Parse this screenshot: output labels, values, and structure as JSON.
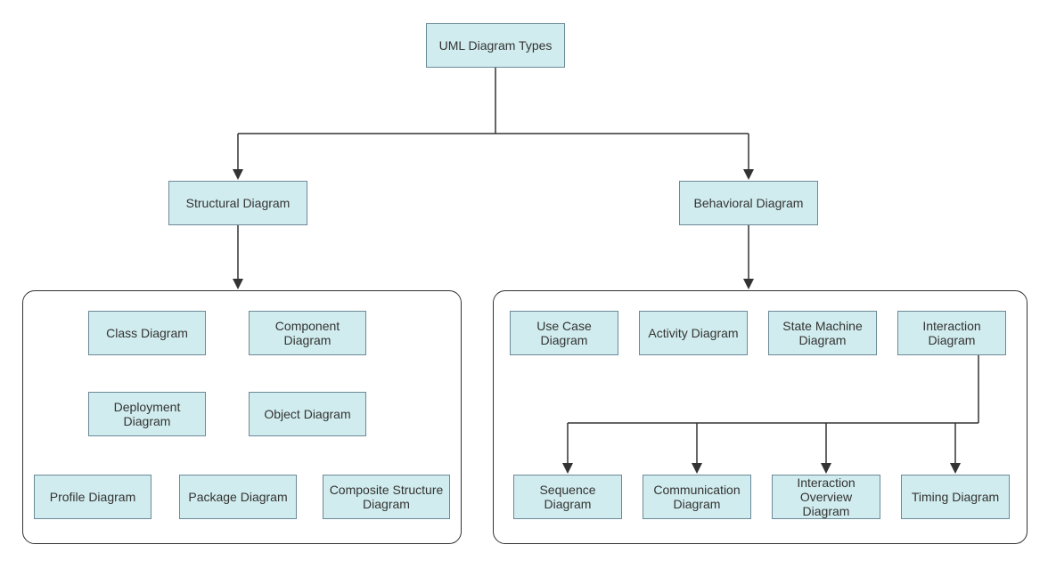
{
  "root": {
    "label": "UML Diagram Types"
  },
  "structural": {
    "label": "Structural Diagram",
    "children": {
      "class": {
        "label": "Class Diagram"
      },
      "component": {
        "label": "Component Diagram"
      },
      "deployment": {
        "label": "Deployment Diagram"
      },
      "object": {
        "label": "Object Diagram"
      },
      "profile": {
        "label": "Profile Diagram"
      },
      "package": {
        "label": "Package Diagram"
      },
      "composite": {
        "label": "Composite Structure Diagram"
      }
    }
  },
  "behavioral": {
    "label": "Behavioral Diagram",
    "children": {
      "usecase": {
        "label": "Use Case Diagram"
      },
      "activity": {
        "label": "Activity Diagram"
      },
      "statemachine": {
        "label": "State Machine Diagram"
      },
      "interaction": {
        "label": "Interaction Diagram",
        "children": {
          "sequence": {
            "label": "Sequence Diagram"
          },
          "communication": {
            "label": "Communication Diagram"
          },
          "overview": {
            "label": "Interaction Overview Diagram"
          },
          "timing": {
            "label": "Timing Diagram"
          }
        }
      }
    }
  }
}
